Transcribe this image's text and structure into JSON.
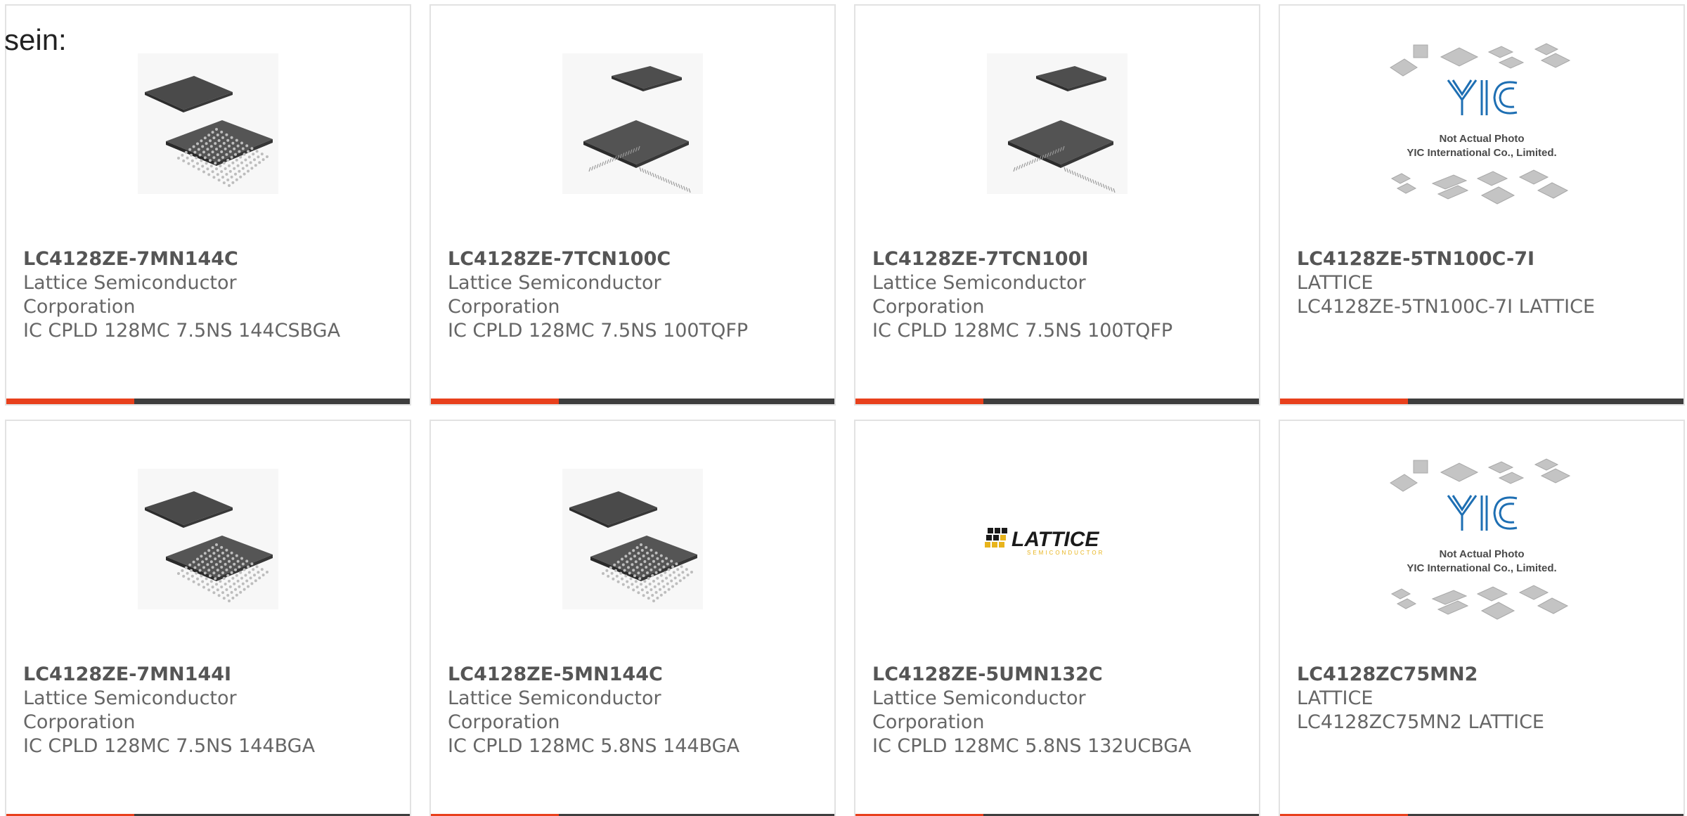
{
  "page": {
    "intro_text": "sein:"
  },
  "theme": {
    "accent_color": "#e8401c",
    "bar_color": "#3e3e3e"
  },
  "products": [
    {
      "part_number": "LC4128ZE-7MN144C",
      "manufacturer_line1": "Lattice Semiconductor",
      "manufacturer_line2": "Corporation",
      "description": "IC CPLD 128MC 7.5NS 144CSBGA",
      "image": "bga-chip-photo"
    },
    {
      "part_number": "LC4128ZE-7TCN100C",
      "manufacturer_line1": "Lattice Semiconductor",
      "manufacturer_line2": "Corporation",
      "description": "IC CPLD 128MC 7.5NS 100TQFP",
      "image": "tqfp-chip-photo"
    },
    {
      "part_number": "LC4128ZE-7TCN100I",
      "manufacturer_line1": "Lattice Semiconductor",
      "manufacturer_line2": "Corporation",
      "description": "IC CPLD 128MC 7.5NS 100TQFP",
      "image": "tqfp-chip-photo"
    },
    {
      "part_number": "LC4128ZE-5TN100C-7I",
      "manufacturer_line1": "LATTICE",
      "manufacturer_line2": "LC4128ZE-5TN100C-7I LATTICE",
      "description": "",
      "image": "yic-placeholder",
      "placeholder_line1": "Not Actual Photo",
      "placeholder_line2": "YIC International Co., Limited."
    },
    {
      "part_number": "LC4128ZE-7MN144I",
      "manufacturer_line1": "Lattice Semiconductor",
      "manufacturer_line2": "Corporation",
      "description": "IC CPLD 128MC 7.5NS 144BGA",
      "image": "bga-chip-photo"
    },
    {
      "part_number": "LC4128ZE-5MN144C",
      "manufacturer_line1": "Lattice Semiconductor",
      "manufacturer_line2": "Corporation",
      "description": "IC CPLD 128MC 5.8NS 144BGA",
      "image": "bga-chip-photo"
    },
    {
      "part_number": "LC4128ZE-5UMN132C",
      "manufacturer_line1": "Lattice Semiconductor",
      "manufacturer_line2": "Corporation",
      "description": "IC CPLD 128MC 5.8NS 132UCBGA",
      "image": "lattice-logo",
      "logo_text": "LATTICE",
      "logo_subtext": "SEMICONDUCTOR"
    },
    {
      "part_number": "LC4128ZC75MN2",
      "manufacturer_line1": "LATTICE",
      "manufacturer_line2": "LC4128ZC75MN2 LATTICE",
      "description": "",
      "image": "yic-placeholder",
      "placeholder_line1": "Not Actual Photo",
      "placeholder_line2": "YIC International Co., Limited."
    }
  ]
}
